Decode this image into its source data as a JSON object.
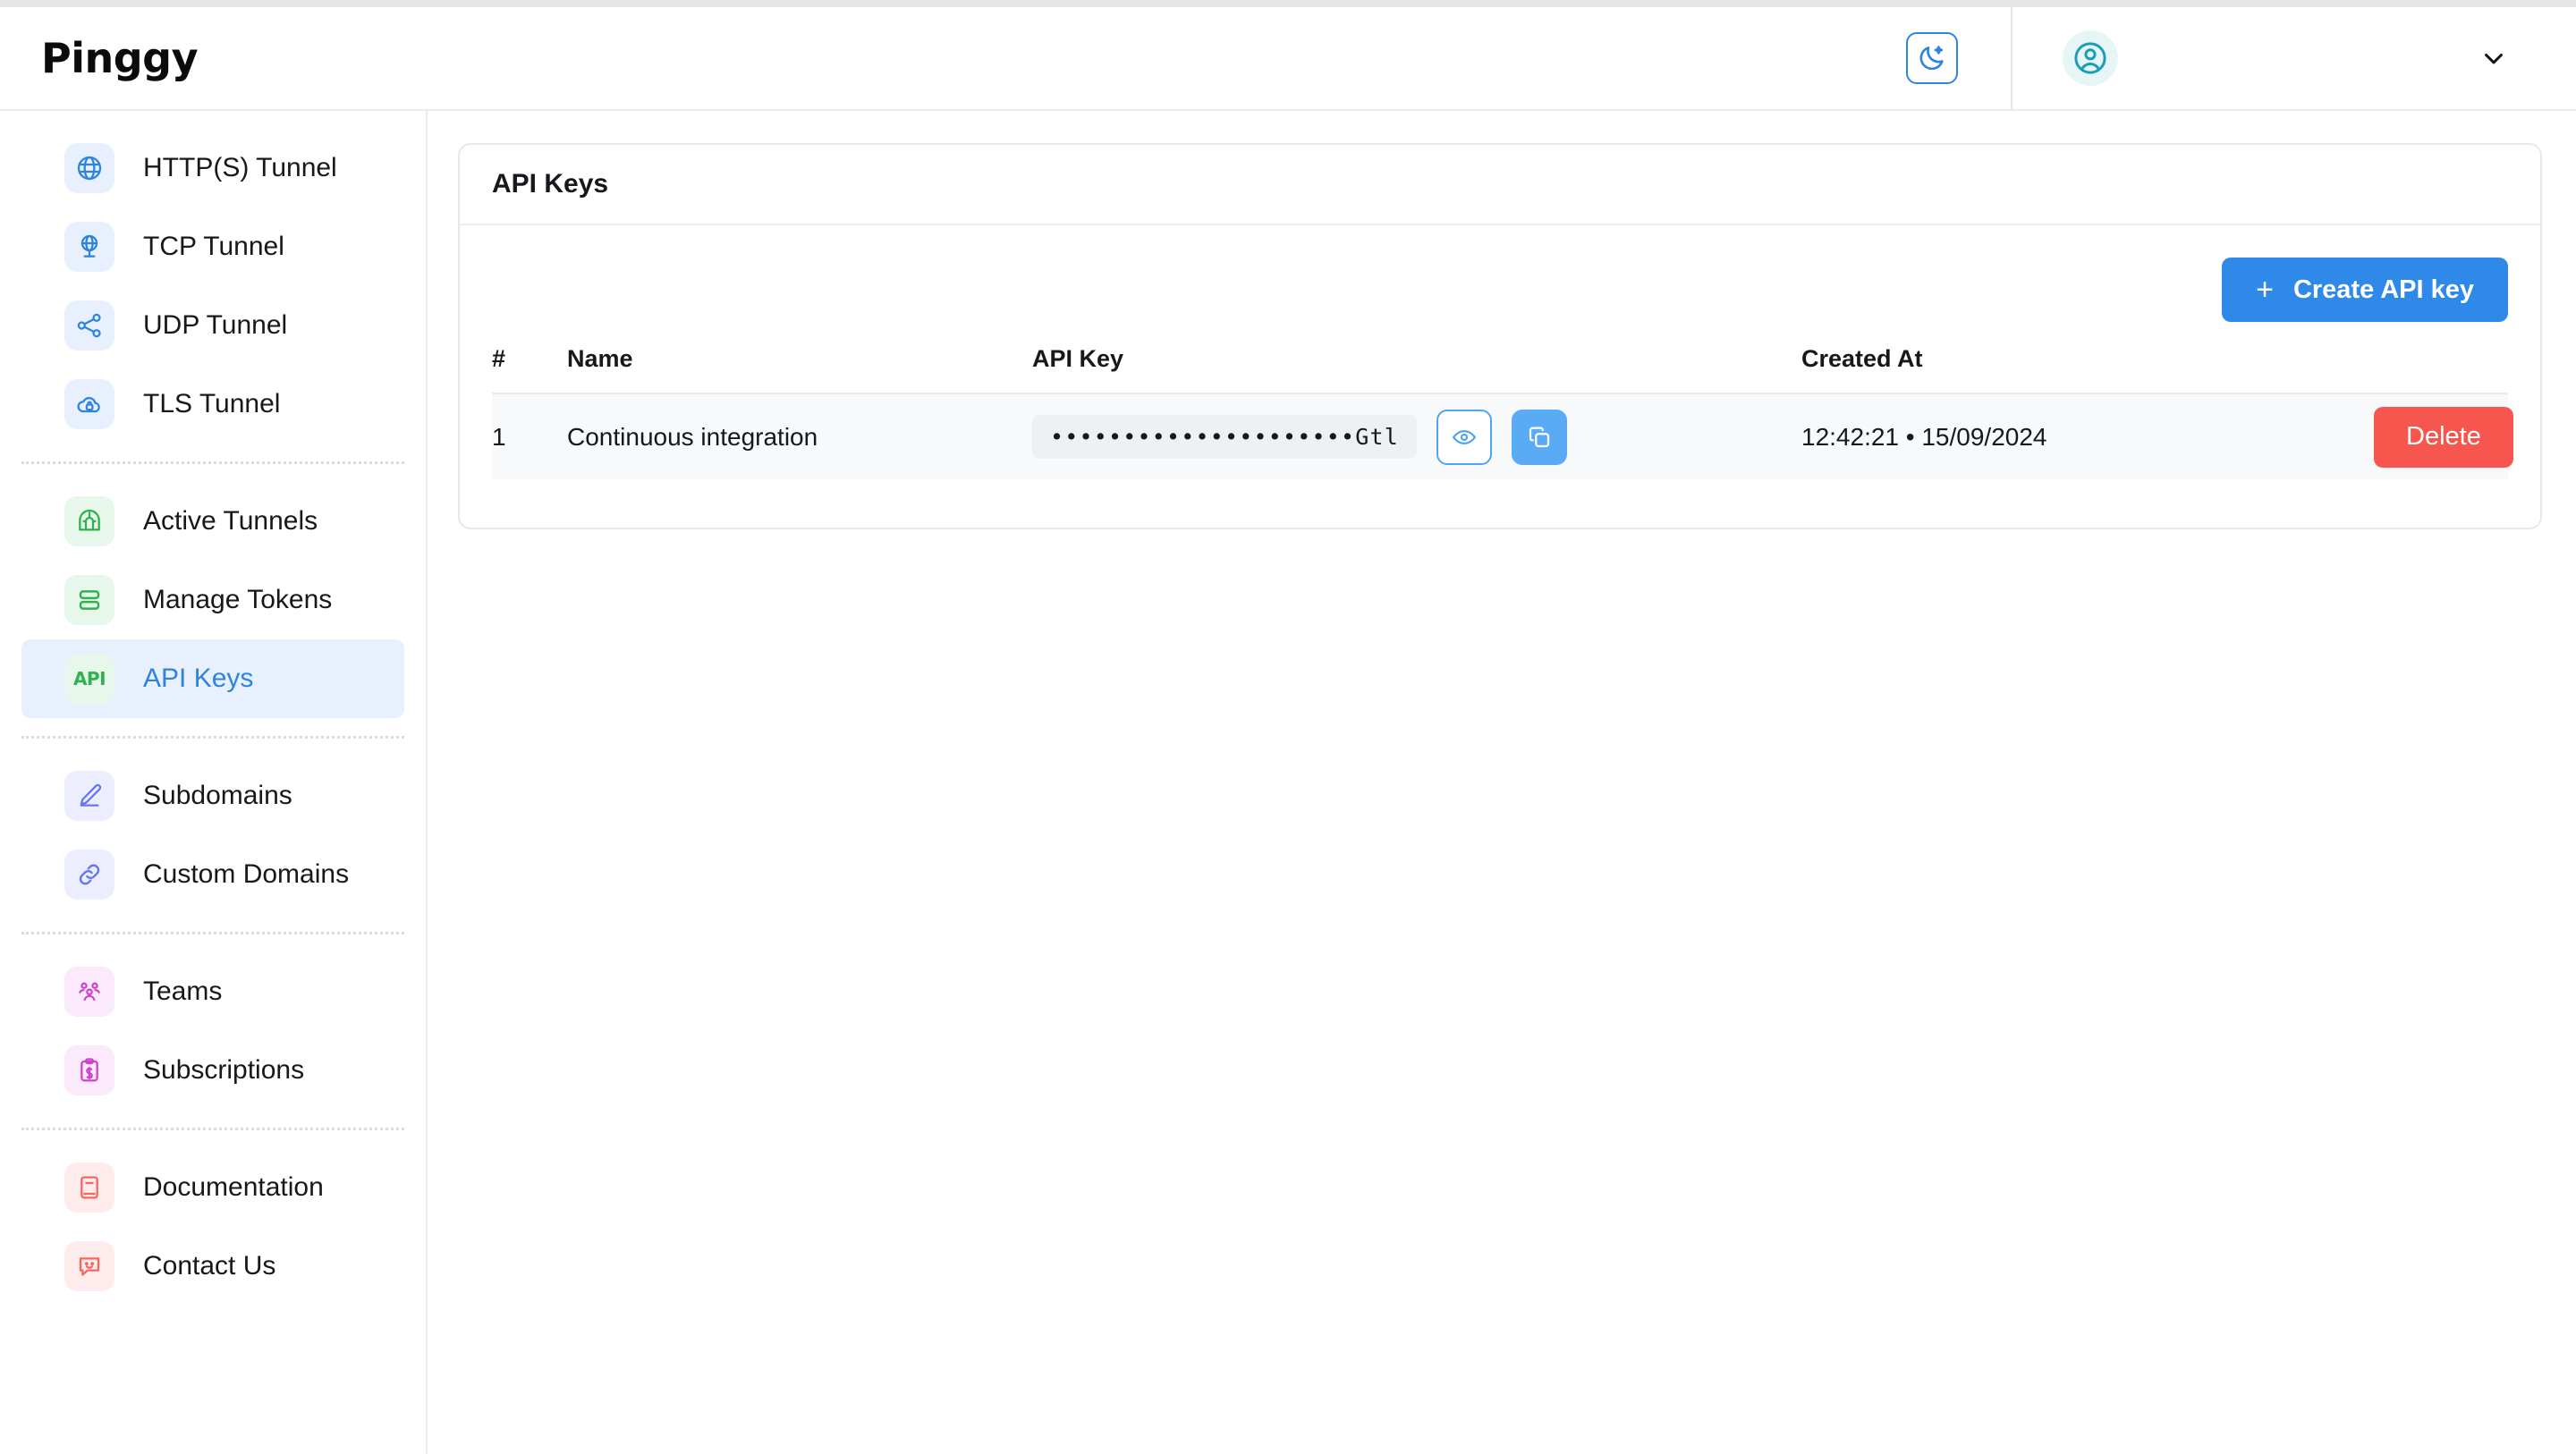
{
  "header": {
    "brand": "Pinggy",
    "theme_toggle_icon": "moon-icon",
    "avatar_icon": "user-circle-icon",
    "chevron_icon": "chevron-down-icon"
  },
  "sidebar": {
    "groups": [
      {
        "items": [
          {
            "label": "HTTP(S) Tunnel",
            "icon": "globe-www-icon",
            "tint": "tint-blue",
            "active": false
          },
          {
            "label": "TCP Tunnel",
            "icon": "globe-pin-icon",
            "tint": "tint-blue",
            "active": false
          },
          {
            "label": "UDP Tunnel",
            "icon": "share-nodes-icon",
            "tint": "tint-blue",
            "active": false
          },
          {
            "label": "TLS Tunnel",
            "icon": "cloud-lock-icon",
            "tint": "tint-blue",
            "active": false
          }
        ]
      },
      {
        "items": [
          {
            "label": "Active Tunnels",
            "icon": "tunnel-icon",
            "tint": "tint-green",
            "active": false
          },
          {
            "label": "Manage Tokens",
            "icon": "tokens-icon",
            "tint": "tint-green",
            "active": false
          },
          {
            "label": "API Keys",
            "icon": "api-badge-icon",
            "tint": "tint-green",
            "active": true
          }
        ]
      },
      {
        "items": [
          {
            "label": "Subdomains",
            "icon": "pencil-edit-icon",
            "tint": "tint-indigo",
            "active": false
          },
          {
            "label": "Custom Domains",
            "icon": "link-chain-icon",
            "tint": "tint-indigo",
            "active": false
          }
        ]
      },
      {
        "items": [
          {
            "label": "Teams",
            "icon": "users-group-icon",
            "tint": "tint-pink",
            "active": false
          },
          {
            "label": "Subscriptions",
            "icon": "clipboard-dollar-icon",
            "tint": "tint-pink",
            "active": false
          }
        ]
      },
      {
        "items": [
          {
            "label": "Documentation",
            "icon": "book-icon",
            "tint": "tint-red",
            "active": false
          },
          {
            "label": "Contact Us",
            "icon": "chat-smile-icon",
            "tint": "tint-red",
            "active": false
          }
        ]
      }
    ]
  },
  "panel": {
    "title": "API Keys",
    "create_button": {
      "label": "Create API key",
      "plus": "+"
    },
    "table": {
      "headers": [
        "#",
        "Name",
        "API Key",
        "Created At",
        ""
      ],
      "rows": [
        {
          "num": "1",
          "name": "Continuous integration",
          "key_masked": "•••••••••••••••••••••Gtl",
          "reveal_icon": "eye-icon",
          "copy_icon": "copy-icon",
          "created_at": "12:42:21 • 15/09/2024",
          "delete_label": "Delete"
        }
      ]
    }
  },
  "colors": {
    "accent_blue": "#2f89e8",
    "danger_red": "#f7564f",
    "active_nav_bg": "#e8f0fd",
    "row_bg": "#f8f9fb"
  }
}
